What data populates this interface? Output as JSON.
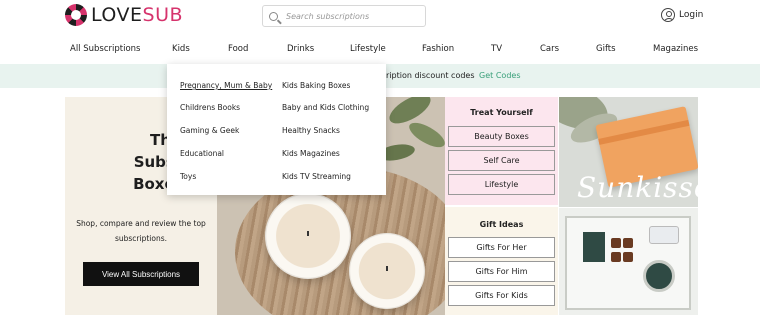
{
  "header": {
    "logo_love": "LOVE",
    "logo_sub": "SUB",
    "search_placeholder": "Search subscriptions",
    "login_label": "Login"
  },
  "nav": {
    "items": [
      "All Subscriptions",
      "Kids",
      "Food",
      "Drinks",
      "Lifestyle",
      "Fashion",
      "TV",
      "Cars",
      "Gifts",
      "Magazines"
    ]
  },
  "promo": {
    "text": "ription discount codes",
    "link": "Get Codes"
  },
  "dropdown": {
    "left": [
      "Pregnancy, Mum & Baby",
      "Childrens Books",
      "Gaming & Geek",
      "Educational",
      "Toys"
    ],
    "right": [
      "Kids Baking Boxes",
      "Baby and Kids Clothing",
      "Healthy Snacks",
      "Kids Magazines",
      "Kids TV Streaming"
    ]
  },
  "hero": {
    "title_lines": [
      "The Best",
      "Subscription",
      "Boxes in The"
    ],
    "subtitle_line1": "Shop, compare and review the top",
    "subtitle_line2": "subscriptions.",
    "button": "View All Subscriptions"
  },
  "treat": {
    "title": "Treat Yourself",
    "items": [
      "Beauty Boxes",
      "Self Care",
      "Lifestyle"
    ]
  },
  "gifts": {
    "title": "Gift Ideas",
    "items": [
      "Gifts For Her",
      "Gifts For Him",
      "Gifts For Kids"
    ]
  },
  "images": {
    "box_script": "Sunkisse"
  },
  "colors": {
    "brand_pink": "#d6336c",
    "promo_bg": "#e8f3ef",
    "promo_link": "#3aa07a",
    "treat_bg": "#fce6ee",
    "gift_bg": "#faf5ea"
  }
}
